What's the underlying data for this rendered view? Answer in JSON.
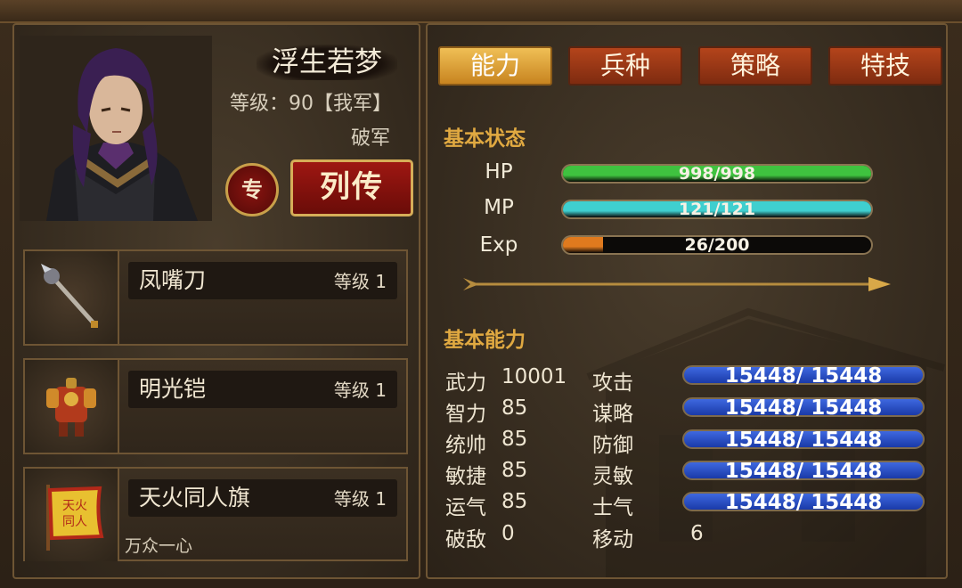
{
  "character": {
    "name": "浮生若梦",
    "level_text": "等级：90【我军】",
    "faction": "破军",
    "special_button": "专",
    "biography_button": "列传"
  },
  "equipment": [
    {
      "name": "凤嘴刀",
      "level": "等级 1",
      "skill": "",
      "icon": "weapon-halberd-icon"
    },
    {
      "name": "明光铠",
      "level": "等级 1",
      "skill": "",
      "icon": "armor-icon"
    },
    {
      "name": "天火同人旗",
      "level": "等级 1",
      "skill": "万众一心",
      "icon": "banner-icon"
    }
  ],
  "tabs": [
    {
      "label": "能力",
      "active": true
    },
    {
      "label": "兵种",
      "active": false
    },
    {
      "label": "策略",
      "active": false
    },
    {
      "label": "特技",
      "active": false
    }
  ],
  "basic_status": {
    "title": "基本状态",
    "bars": [
      {
        "label": "HP",
        "text": "998/998",
        "fraction": 1.0,
        "color": "#3fc23f"
      },
      {
        "label": "MP",
        "text": "121/121",
        "fraction": 1.0,
        "color": "#3fcfcf"
      },
      {
        "label": "Exp",
        "text": "26/200",
        "fraction": 0.13,
        "color": "#e07a1e"
      }
    ]
  },
  "basic_ability": {
    "title": "基本能力",
    "attributes": [
      {
        "label": "武力",
        "value": "10001"
      },
      {
        "label": "智力",
        "value": "85"
      },
      {
        "label": "统帅",
        "value": "85"
      },
      {
        "label": "敏捷",
        "value": "85"
      },
      {
        "label": "运气",
        "value": "85"
      },
      {
        "label": "破敌",
        "value": "0"
      }
    ],
    "combat": [
      {
        "label": "攻击",
        "value": "15448/ 15448"
      },
      {
        "label": "谋略",
        "value": "15448/ 15448"
      },
      {
        "label": "防御",
        "value": "15448/ 15448"
      },
      {
        "label": "灵敏",
        "value": "15448/ 15448"
      },
      {
        "label": "士气",
        "value": "15448/ 15448"
      }
    ],
    "move": {
      "label": "移动",
      "value": "6"
    }
  }
}
